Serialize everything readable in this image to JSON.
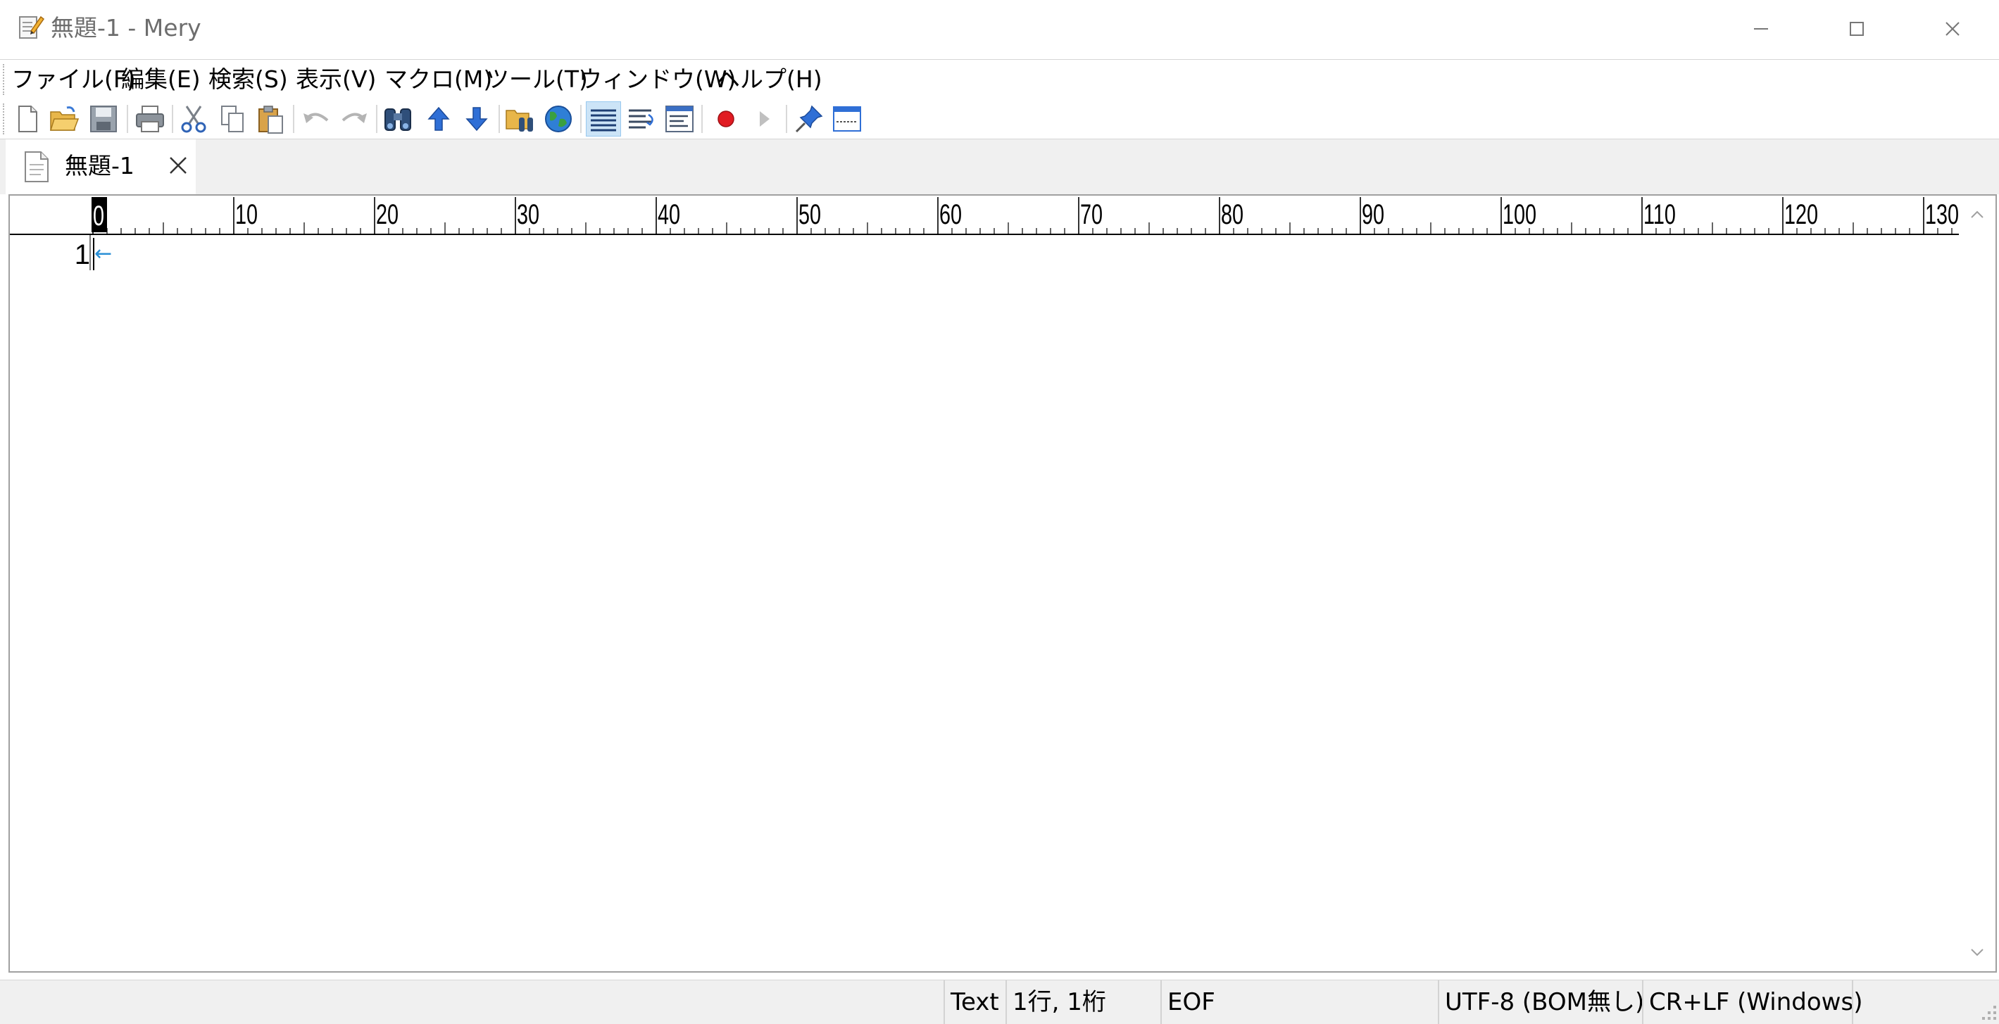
{
  "window": {
    "title": "無題-1 - Mery",
    "buttons": [
      "minimize-icon",
      "maximize-icon",
      "close-icon"
    ]
  },
  "menu": [
    {
      "label": "ファイル(F)"
    },
    {
      "label": "編集(E)"
    },
    {
      "label": "検索(S)"
    },
    {
      "label": "表示(V)"
    },
    {
      "label": "マクロ(M)"
    },
    {
      "label": "ツール(T)"
    },
    {
      "label": "ウィンドウ(W)"
    },
    {
      "label": "ヘルプ(H)"
    }
  ],
  "toolbar": {
    "buttons": [
      "new-file-icon",
      "open-folder-icon",
      "save-icon",
      "print-icon",
      "cut-icon",
      "copy-icon",
      "paste-icon",
      "undo-icon",
      "redo-icon",
      "find-icon",
      "find-previous-icon",
      "find-next-icon",
      "find-in-files-icon",
      "web-search-icon",
      "no-wrap-icon",
      "wrap-by-chars-icon",
      "wrap-by-window-icon",
      "record-macro-icon",
      "run-macro-icon",
      "pin-icon",
      "output-window-icon"
    ],
    "active": "no-wrap-icon"
  },
  "tabs": [
    {
      "label": "無題-1"
    }
  ],
  "ruler": {
    "labels": [
      "0",
      "10",
      "20",
      "30",
      "40",
      "50",
      "60",
      "70",
      "80",
      "90",
      "100",
      "110",
      "120",
      "130"
    ],
    "current_column": "0"
  },
  "editor": {
    "line_numbers": [
      "1"
    ],
    "eol_symbol": "←",
    "content": ""
  },
  "statusbar": {
    "mode": "Text",
    "position": "1行, 1桁",
    "eof": "EOF",
    "encoding": "UTF-8 (BOM無し)",
    "line_ending": "CR+LF (Windows)"
  },
  "colors": {
    "accent": "#2a8fd6",
    "record": "#e11b22",
    "tab_strip": "#f0f0f0",
    "status_bar": "#f0f0f0"
  }
}
